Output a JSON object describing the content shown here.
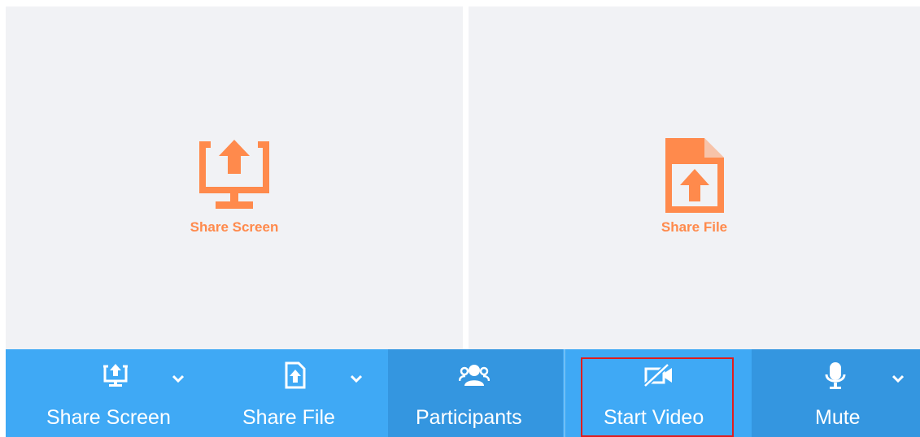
{
  "panels": {
    "share_screen": {
      "label": "Share Screen",
      "icon": "share-screen-icon"
    },
    "share_file": {
      "label": "Share File",
      "icon": "share-file-icon"
    }
  },
  "toolbar": {
    "share_screen": {
      "label": "Share Screen",
      "icon": "share-screen-icon",
      "has_dropdown": true
    },
    "share_file": {
      "label": "Share File",
      "icon": "share-file-icon",
      "has_dropdown": true
    },
    "participants": {
      "label": "Participants",
      "icon": "participants-icon"
    },
    "start_video": {
      "label": "Start Video",
      "icon": "video-off-icon",
      "highlighted": true
    },
    "mute": {
      "label": "Mute",
      "icon": "microphone-icon",
      "has_dropdown": true
    }
  },
  "colors": {
    "accent_orange": "#ff8a4c",
    "toolbar_blue": "#3fa9f5",
    "toolbar_blue_dark": "#3496e0",
    "panel_bg": "#f1f2f5",
    "highlight_red": "#e11d1d"
  }
}
